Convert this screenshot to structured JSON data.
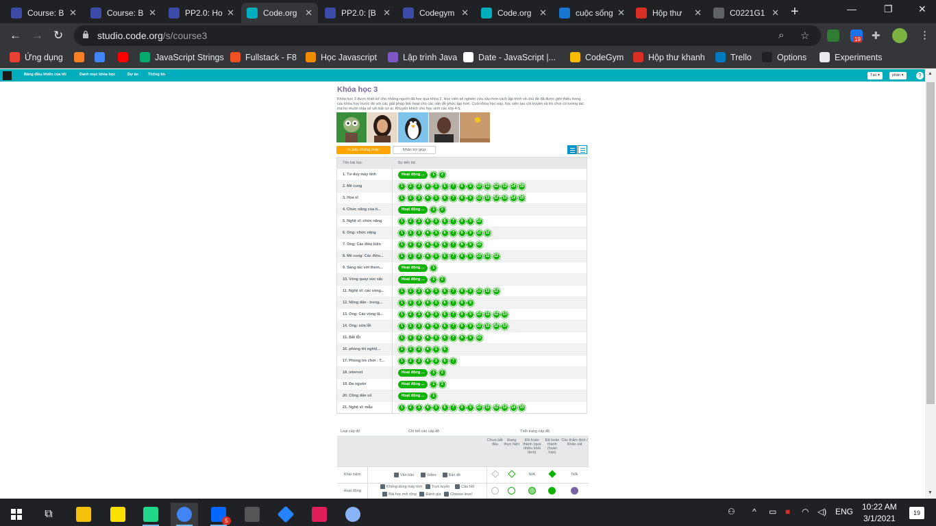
{
  "browser": {
    "tabs": [
      {
        "title": "Course: B",
        "color": "#3b4ba7",
        "active": false
      },
      {
        "title": "Course: B",
        "color": "#3b4ba7",
        "active": false
      },
      {
        "title": "PP2.0: Ho",
        "color": "#3b4ba7",
        "active": false
      },
      {
        "title": "Code.org",
        "color": "#00adbc",
        "active": true
      },
      {
        "title": "PP2.0: [B",
        "color": "#3b4ba7",
        "active": false
      },
      {
        "title": "Codegym",
        "color": "#3b4ba7",
        "active": false
      },
      {
        "title": "Code.org",
        "color": "#00adbc",
        "active": false
      },
      {
        "title": "cuộc sống",
        "color": "#1976d2",
        "active": false
      },
      {
        "title": "Hộp thư",
        "color": "#d93025",
        "active": false
      },
      {
        "title": "C0221G1",
        "color": "#5f6368",
        "active": false
      }
    ],
    "url_host": "studio.code.org",
    "url_path": "/s/course3",
    "ext_badge": "19",
    "bookmarks": [
      {
        "label": "Ứng dụng",
        "color": "#e94235"
      },
      {
        "label": "",
        "color": "#f58025"
      },
      {
        "label": "",
        "color": "#4285f4"
      },
      {
        "label": "",
        "color": "#ff0000"
      },
      {
        "label": "JavaScript Strings",
        "color": "#04aa6d"
      },
      {
        "label": "Fullstack - F8",
        "color": "#f05123"
      },
      {
        "label": "Học Javascript",
        "color": "#f28b00"
      },
      {
        "label": "Lập trình Java",
        "color": "#7e57c2"
      },
      {
        "label": "Date - JavaScript |...",
        "color": "#ffffff"
      },
      {
        "label": "CodeGym",
        "color": "#fbbc04"
      },
      {
        "label": "Hộp thư khanh",
        "color": "#d93025"
      },
      {
        "label": "Trello",
        "color": "#0079bf"
      },
      {
        "label": "Options",
        "color": "#202124"
      },
      {
        "label": "Experiments",
        "color": "#e8eaed"
      }
    ]
  },
  "site": {
    "nav": [
      "Bảng điều khiển của tôi",
      "Danh mục khóa học",
      "Dự án",
      "Thông tin"
    ],
    "lang_button": "Tạo ▾",
    "user_button": "phan ▾",
    "help": "?"
  },
  "course": {
    "title": "Khóa học 3",
    "description": "Khóa học 3 được thiết kế cho những người đã học qua khóa 2. Học viên sẽ nghiên cứu sâu hơn cách lập trình về chủ đề đã được giới thiệu trong các khóa học trước đó với các giải pháp linh hoạt cho các vấn đề phức tạp hơn. Cuối khóa học này, học viên tạo cốt truyện và trò chơi có tương tác mà họ muốn chia sẻ với bất cứ ai. Khuyến khích cho học sinh các lớp 4-5.",
    "certificate_button": "In giấy chứng nhận",
    "help_button": "Nhận trợ giúp",
    "table_headers": [
      "Tên bài học",
      "Sự tiến bộ"
    ],
    "lessons": [
      {
        "name": "1. Tư duy máy tính",
        "pill": "Hoạt động ...",
        "levels": 2
      },
      {
        "name": "2. Mê cung",
        "pill": "",
        "levels": 15
      },
      {
        "name": "3. Họa sĩ",
        "pill": "",
        "levels": 15
      },
      {
        "name": "4. Chức năng của tỉ...",
        "pill": "Hoạt động ...",
        "levels": 2
      },
      {
        "name": "5. Nghệ sĩ: chức năng",
        "pill": "",
        "levels": 10
      },
      {
        "name": "6. Ong: chức năng",
        "pill": "",
        "levels": 11
      },
      {
        "name": "7. Ong: Các điều kiện",
        "pill": "",
        "levels": 10
      },
      {
        "name": "8. Mê cung: Các điều...",
        "pill": "",
        "levels": 12
      },
      {
        "name": "9. Sáng tác với them...",
        "pill": "Hoạt động ...",
        "levels": 1
      },
      {
        "name": "10. Vòng quay xúc sắc",
        "pill": "Hoạt động ...",
        "levels": 2
      },
      {
        "name": "11. Nghệ sĩ: các vòng...",
        "pill": "",
        "levels": 12
      },
      {
        "name": "12. Nông dân - trong...",
        "pill": "",
        "levels": 9
      },
      {
        "name": "13. Ong: Các vòng lặ...",
        "pill": "",
        "levels": 13
      },
      {
        "name": "14. Ong: sửa lỗi",
        "pill": "",
        "levels": 13
      },
      {
        "name": "15. Bắt lỗi",
        "pill": "",
        "levels": 10
      },
      {
        "name": "16. phòng thí nghiệ...",
        "pill": "",
        "levels": 6
      },
      {
        "name": "17. Phòng trò chơi : T...",
        "pill": "",
        "levels": 7
      },
      {
        "name": "18. internet",
        "pill": "Hoạt động ...",
        "levels": 2
      },
      {
        "name": "19. Đa nguồn",
        "pill": "Hoạt động ...",
        "levels": 2
      },
      {
        "name": "20. Công dân số",
        "pill": "Hoạt động ...",
        "levels": 1
      },
      {
        "name": "21. Nghệ sĩ: mẫu",
        "pill": "",
        "levels": 15
      }
    ]
  },
  "legend": {
    "heads": [
      "Loại cấp độ",
      "Chi tiết các cấp độ",
      "Tình trạng cấp độ"
    ],
    "status_cols": [
      "Chưa bắt đầu",
      "Đang thực hiện",
      "Đã hoàn thành (quá nhiều khối lệnh)",
      "Đã hoàn thành (hoàn hảo)",
      "Các thẩm định / Khảo sát"
    ],
    "rows": [
      {
        "type": "Khái niệm",
        "details": [
          "Văn bản",
          "Video",
          "Bản đồ"
        ],
        "na1": "N/A",
        "na2": "N/A"
      },
      {
        "type": "Hoạt động",
        "details": [
          "Không dùng máy tính",
          "Trực tuyến",
          "Câu hỏi",
          "Bài học mở rộng",
          "Đánh giá",
          "Choose level"
        ]
      }
    ]
  },
  "taskbar": {
    "time": "10:22 AM",
    "date": "3/1/2021",
    "lang": "ENG",
    "notif": "19",
    "zalo_badge": "5"
  }
}
